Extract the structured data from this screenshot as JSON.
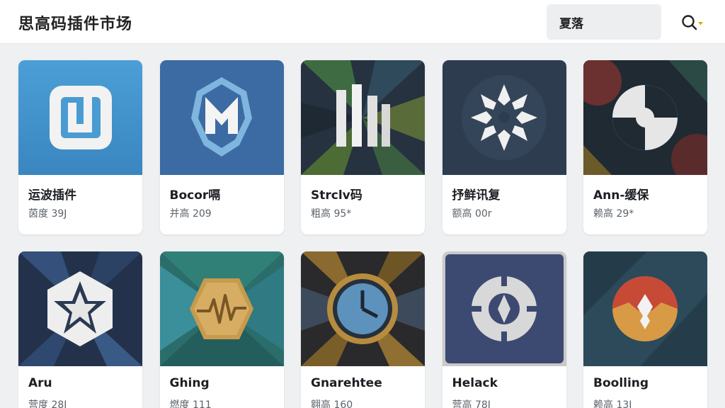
{
  "header": {
    "title": "思高码插件市场",
    "search_value": "夏落",
    "search_icon": "search-icon",
    "dropdown_icon": "caret-down-icon",
    "accent_color": "#e6a700"
  },
  "plugins": [
    {
      "name": "运波插件",
      "meta": "茵度 39J",
      "icon": "rounded-square-logo-icon"
    },
    {
      "name": "Bocor嗝",
      "meta": "并高 209",
      "icon": "shield-crest-logo-icon"
    },
    {
      "name": "Strclv码",
      "meta": "粗高 95*",
      "icon": "pillars-logo-icon"
    },
    {
      "name": "抒鲜讯复",
      "meta": "额高 00r",
      "icon": "snowflake-logo-icon"
    },
    {
      "name": "Ann-缓保",
      "meta": "赖高 29*",
      "icon": "swirl-logo-icon"
    },
    {
      "name": "Aru",
      "meta": "营度 28J",
      "icon": "hexagon-star-logo-icon"
    },
    {
      "name": "Ghing",
      "meta": "燃度 111",
      "icon": "pulse-hexagon-logo-icon"
    },
    {
      "name": "Gnarehtee",
      "meta": "翱高 160",
      "icon": "clock-gauge-logo-icon"
    },
    {
      "name": "Helack",
      "meta": "营高 78J",
      "icon": "compass-circle-logo-icon"
    },
    {
      "name": "Boolling",
      "meta": "赖高 13J",
      "icon": "split-badge-logo-icon"
    }
  ]
}
